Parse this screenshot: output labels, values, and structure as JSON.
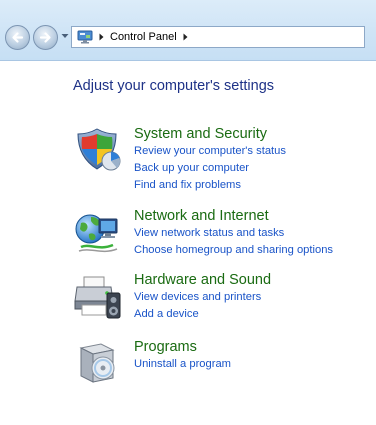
{
  "address_bar": {
    "breadcrumb": "Control Panel"
  },
  "main": {
    "title": "Adjust your computer's settings",
    "categories": [
      {
        "title": "System and Security",
        "icon": "shield-icon",
        "links": [
          "Review your computer's status",
          "Back up your computer",
          "Find and fix problems"
        ]
      },
      {
        "title": "Network and Internet",
        "icon": "network-globe-icon",
        "links": [
          "View network status and tasks",
          "Choose homegroup and sharing options"
        ]
      },
      {
        "title": "Hardware and Sound",
        "icon": "printer-speaker-icon",
        "links": [
          "View devices and printers",
          "Add a device"
        ]
      },
      {
        "title": "Programs",
        "icon": "programs-disc-icon",
        "links": [
          "Uninstall a program"
        ]
      }
    ]
  },
  "colors": {
    "title": "#1e3287",
    "category_title": "#1a6b12",
    "link": "#1a54c8"
  }
}
